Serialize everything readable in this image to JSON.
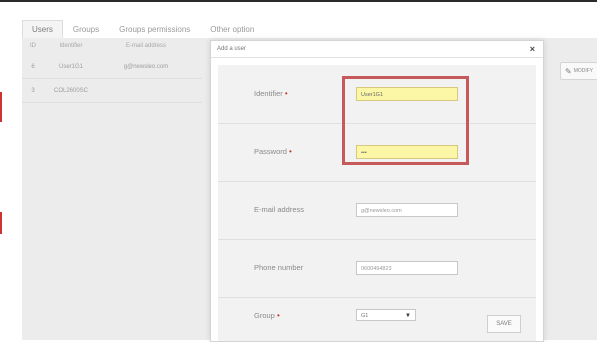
{
  "tabs": [
    "Users",
    "Groups",
    "Groups permissions",
    "Other option"
  ],
  "table": {
    "headers": [
      "ID",
      "Identifier",
      "E-mail address"
    ],
    "rows": [
      {
        "id": "6",
        "identifier": "User1G1",
        "email": "g@newsleo.com"
      },
      {
        "id": "3",
        "identifier": "COL2600SC",
        "email": ""
      }
    ]
  },
  "modify_label": "MODIFY",
  "dialog": {
    "title": "Add a user",
    "close": "×",
    "fields": {
      "identifier": {
        "label": "Identifier",
        "value": "User1G1"
      },
      "password": {
        "label": "Password",
        "value": "•••"
      },
      "email": {
        "label": "E-mail address",
        "value": "g@newsleo.com"
      },
      "phone": {
        "label": "Phone number",
        "value": "0600494823"
      },
      "group": {
        "label": "Group",
        "value": "G1"
      }
    },
    "required_mark": "•",
    "save_label": "SAVE"
  },
  "colors": {
    "highlight": "#fbf7a6",
    "annotation": "#c65a5a",
    "required": "#c0392b"
  }
}
